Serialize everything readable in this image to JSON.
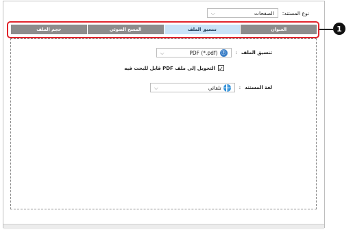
{
  "doc_type": {
    "label": "نوع المستند:",
    "value": "الصفحات"
  },
  "tabs": [
    {
      "label": "العنوان",
      "active": false
    },
    {
      "label": "تنسيق الملف",
      "active": true
    },
    {
      "label": "المسح الضوئي",
      "active": false
    },
    {
      "label": "حجم الملف",
      "active": false
    }
  ],
  "callout": {
    "number": "1"
  },
  "file_format": {
    "label": "تنسيق الملف",
    "colon": ":",
    "value": "PDF (*.pdf)",
    "icon": "pdf-icon"
  },
  "convert": {
    "label": "التحويل إلى ملف PDF قابل للبحث فيه",
    "checked": true,
    "check_glyph": "✓"
  },
  "doc_language": {
    "label": "لغة المستند",
    "colon": ":",
    "value": "تلقائي",
    "icon": "globe-icon"
  },
  "colors": {
    "active_tab": "#c9e3f7",
    "inactive_tab": "#8c8c8c",
    "callout": "#e0242b"
  }
}
